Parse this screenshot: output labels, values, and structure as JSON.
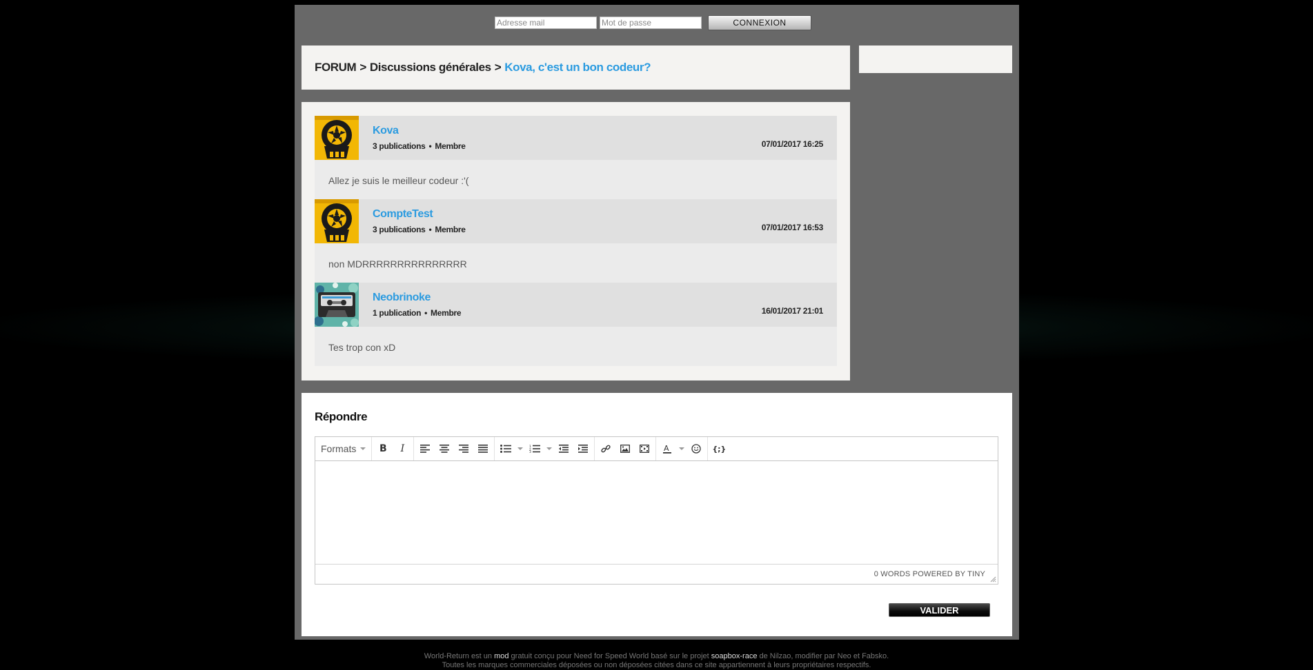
{
  "login": {
    "email_placeholder": "Adresse mail",
    "password_placeholder": "Mot de passe",
    "button_label": "CONNEXION"
  },
  "breadcrumb": {
    "root": "FORUM",
    "separator": ">",
    "category": "Discussions générales",
    "current": "Kova, c'est un bon codeur?"
  },
  "posts": [
    {
      "author": "Kova",
      "publications": "3 publications",
      "role": "Membre",
      "date": "07/01/2017 16:25",
      "avatar_icon": "wheel-skull-icon",
      "body": "Allez je suis le meilleur codeur :'("
    },
    {
      "author": "CompteTest",
      "publications": "3 publications",
      "role": "Membre",
      "date": "07/01/2017 16:53",
      "avatar_icon": "wheel-skull-icon",
      "body": "non MDRRRRRRRRRRRRRRR"
    },
    {
      "author": "Neobrinoke",
      "publications": "1 publication",
      "role": "Membre",
      "date": "16/01/2017 21:01",
      "avatar_icon": "cassette-icon",
      "body": "Tes trop con xD"
    }
  ],
  "reply": {
    "title": "Répondre",
    "formats_label": "Formats",
    "toolbar_icons": [
      "bold-icon",
      "italic-icon",
      "align-left-icon",
      "align-center-icon",
      "align-right-icon",
      "align-justify-icon",
      "bullet-list-icon",
      "numbered-list-icon",
      "outdent-icon",
      "indent-icon",
      "link-icon",
      "image-icon",
      "media-icon",
      "text-color-icon",
      "emoticon-icon",
      "code-icon"
    ],
    "status_text": "0 WORDS POWERED BY TINY",
    "submit_label": "VALIDER"
  },
  "footer": {
    "line1_a": "World-Return est un",
    "line1_mod": "mod",
    "line1_b": "gratuit conçu pour Need for Speed World basé sur le projet",
    "line1_project": "soapbox-race",
    "line1_c": "de Nilzao, modifier par Neo et Fabsko.",
    "line2": "Toutes les marques commerciales déposées ou non déposées citées dans ce site appartiennent à leurs propriétaires respectifs."
  },
  "colors": {
    "accent": "#2b9be0",
    "page_bg": "#000000",
    "frame_bg": "#686868",
    "panel_bg": "#f4f3f1"
  }
}
